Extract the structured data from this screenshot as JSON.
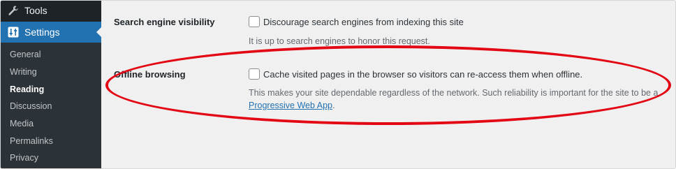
{
  "sidebar": {
    "tools_label": "Tools",
    "settings_label": "Settings",
    "submenu": [
      {
        "label": "General"
      },
      {
        "label": "Writing"
      },
      {
        "label": "Reading"
      },
      {
        "label": "Discussion"
      },
      {
        "label": "Media"
      },
      {
        "label": "Permalinks"
      },
      {
        "label": "Privacy"
      }
    ],
    "current": "Reading"
  },
  "settings": {
    "search_visibility": {
      "label": "Search engine visibility",
      "checkbox_label": "Discourage search engines from indexing this site",
      "checked": false,
      "description": "It is up to search engines to honor this request."
    },
    "offline_browsing": {
      "label": "Offline browsing",
      "checkbox_label": "Cache visited pages in the browser so visitors can re-access them when offline.",
      "checked": false,
      "description": "This makes your site dependable regardless of the network. Such reliability is important for the site to be a",
      "link_text": "Progressive Web App",
      "after_link": "."
    }
  },
  "colors": {
    "sidebar_bg": "#1d2327",
    "submenu_bg": "#2c3338",
    "accent": "#2271b1",
    "highlight": "#e30613"
  }
}
